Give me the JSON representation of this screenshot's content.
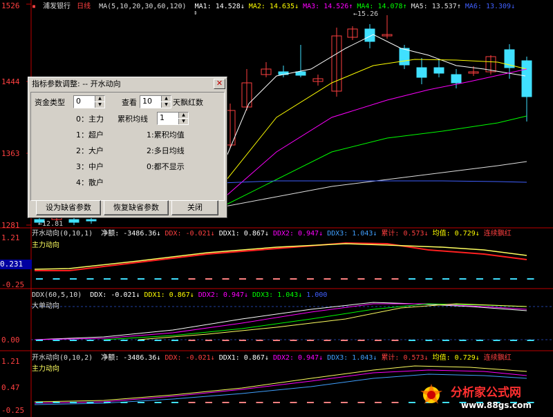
{
  "main_header": {
    "icon": "▪",
    "stock": "浦发银行",
    "period": "日线",
    "ma_params": "MA(5,10,20,30,60,120)",
    "ma": [
      {
        "label": "MA1:",
        "value": "14.528↓",
        "color": "#ffffff"
      },
      {
        "label": "MA2:",
        "value": "14.635↓",
        "color": "#ffff00"
      },
      {
        "label": "MA3:",
        "value": "14.526↑",
        "color": "#ff00ff"
      },
      {
        "label": "MA4:",
        "value": "14.078↑",
        "color": "#00ff00"
      },
      {
        "label": "MA5:",
        "value": "13.537↑",
        "color": "#e0e0e0"
      },
      {
        "label": "MA6:",
        "value": "13.309↓",
        "color": "#4060ff"
      }
    ]
  },
  "price_axis": [
    "1526",
    "1444",
    "1363",
    "1281"
  ],
  "annotations": {
    "high": "15.26",
    "low": "12.81"
  },
  "panel1": {
    "name": "开水动向",
    "params": "(0,10,1)",
    "items": [
      {
        "label": "净额:",
        "value": "-3486.36↓",
        "color": "#ffffff"
      },
      {
        "label": "DDX:",
        "value": "-0.021↓",
        "color": "#ff4040"
      },
      {
        "label": "DDX1:",
        "value": "0.867↓",
        "color": "#ffffff"
      },
      {
        "label": "DDX2:",
        "value": "0.947↓",
        "color": "#ff00ff"
      },
      {
        "label": "DDX3:",
        "value": "1.043↓",
        "color": "#40a0ff"
      },
      {
        "label": "累计:",
        "value": "0.573↓",
        "color": "#ff4040"
      },
      {
        "label": "均值:",
        "value": "0.729↓",
        "color": "#ffff00"
      },
      {
        "label": "连续飘红",
        "value": "",
        "color": "#ff4040"
      }
    ],
    "subtitle": "主力动向",
    "axis": [
      "1.21",
      "0.231",
      "-0.25"
    ]
  },
  "panel2": {
    "name": "DDX",
    "params": "(60,5,10)",
    "items": [
      {
        "label": "DDX:",
        "value": "-0.021↓",
        "color": "#ffffff"
      },
      {
        "label": "DDX1:",
        "value": "0.867↓",
        "color": "#ffff00"
      },
      {
        "label": "DDX2:",
        "value": "0.947↓",
        "color": "#ff00ff"
      },
      {
        "label": "DDX3:",
        "value": "1.043↓",
        "color": "#00ff00"
      },
      {
        "label": "",
        "value": "1.000",
        "color": "#4060ff"
      }
    ],
    "subtitle": "大单动向",
    "axis": [
      "0.00"
    ]
  },
  "panel3": {
    "name": "开水动向",
    "params": "(0,10,2)",
    "items": [
      {
        "label": "净额:",
        "value": "-3486.36↓",
        "color": "#ffffff"
      },
      {
        "label": "DDX:",
        "value": "-0.021↓",
        "color": "#ff4040"
      },
      {
        "label": "DDX1:",
        "value": "0.867↓",
        "color": "#ffffff"
      },
      {
        "label": "DDX2:",
        "value": "0.947↓",
        "color": "#ff00ff"
      },
      {
        "label": "DDX3:",
        "value": "1.043↓",
        "color": "#40a0ff"
      },
      {
        "label": "累计:",
        "value": "0.573↓",
        "color": "#ff4040"
      },
      {
        "label": "均值:",
        "value": "0.729↓",
        "color": "#ffff00"
      },
      {
        "label": "连续飘红",
        "value": "",
        "color": "#ff4040"
      }
    ],
    "subtitle": "主力动向",
    "axis": [
      "1.21",
      "0.47",
      "-0.25"
    ]
  },
  "dialog": {
    "title": "指标参数调整: -- 开水动向",
    "fund_type_label": "资金类型",
    "fund_type_value": "0",
    "view_label": "查看",
    "view_value": "10",
    "view_suffix": "天飘红数",
    "options_left": [
      "0：主力",
      "1：超户",
      "2：大户",
      "3：中户",
      "4：散户"
    ],
    "cum_label": "累积均线",
    "cum_value": "1",
    "options_right": [
      "1:累积均值",
      "2:多日均线",
      "0:都不显示"
    ],
    "btn_default": "设为缺省参数",
    "btn_restore": "恢复缺省参数",
    "btn_close": "关闭"
  },
  "watermark": {
    "name": "分析家公式网",
    "url": "www.88gs.com"
  }
}
